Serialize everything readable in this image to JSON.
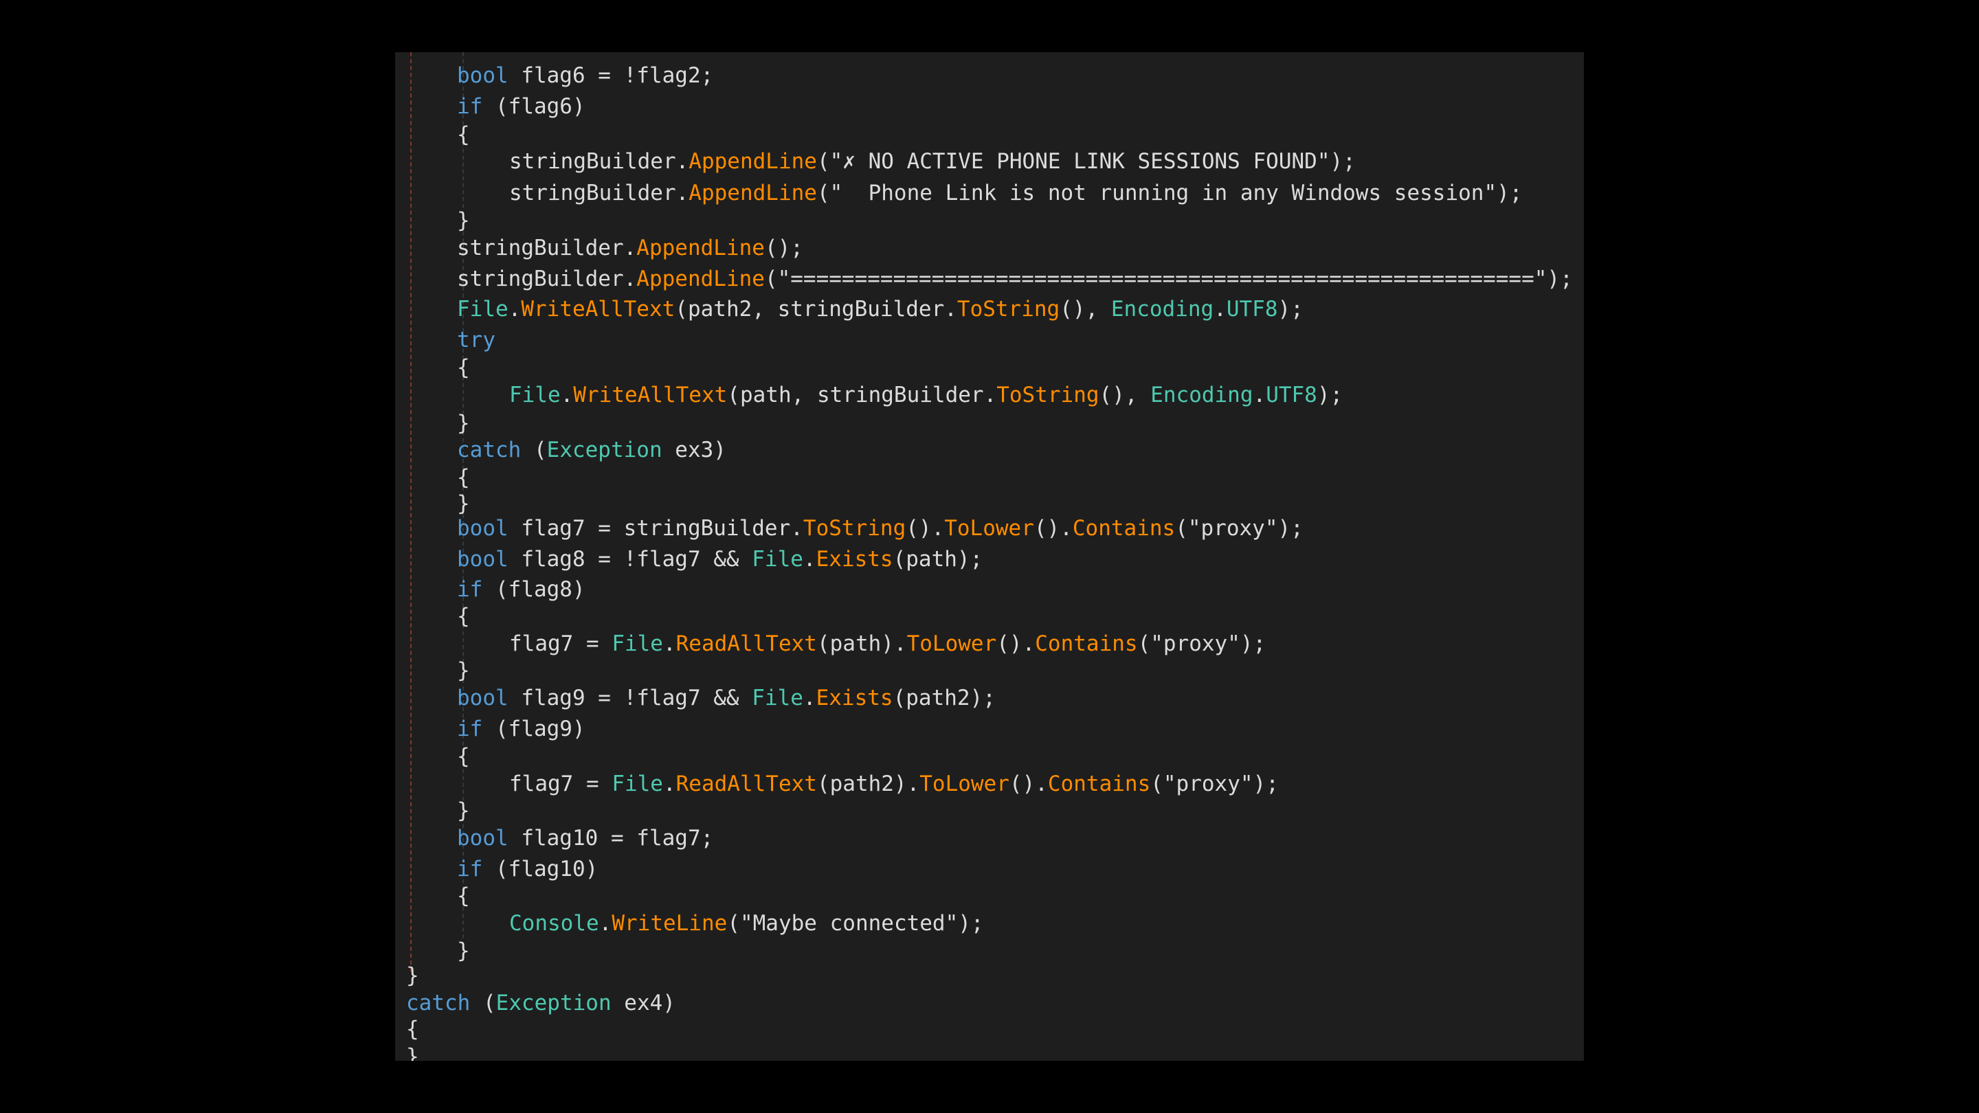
{
  "editor": {
    "theme": {
      "background": "#1e1e1e",
      "keyword": "#569cd6",
      "type": "#4ec9b0",
      "method": "#ff8c00",
      "text": "#dcdcdc"
    },
    "lines": [
      {
        "indent": 1,
        "tokens": [
          [
            "kw",
            "bool"
          ],
          [
            "id",
            " flag6 = !flag2;"
          ]
        ]
      },
      {
        "indent": 1,
        "tokens": [
          [
            "kw",
            "if"
          ],
          [
            "id",
            " (flag6)"
          ]
        ]
      },
      {
        "indent": 1,
        "tokens": [
          [
            "pn",
            "{"
          ]
        ]
      },
      {
        "indent": 2,
        "tokens": [
          [
            "id",
            "stringBuilder."
          ],
          [
            "mth",
            "AppendLine"
          ],
          [
            "str",
            "(\"✗ NO ACTIVE PHONE LINK SESSIONS FOUND\");"
          ]
        ]
      },
      {
        "indent": 2,
        "tokens": [
          [
            "id",
            "stringBuilder."
          ],
          [
            "mth",
            "AppendLine"
          ],
          [
            "str",
            "(\"  Phone Link is not running in any Windows session\");"
          ]
        ]
      },
      {
        "indent": 1,
        "tokens": [
          [
            "pn",
            "}"
          ]
        ]
      },
      {
        "indent": 1,
        "tokens": [
          [
            "id",
            "stringBuilder."
          ],
          [
            "mth",
            "AppendLine"
          ],
          [
            "pn",
            "();"
          ]
        ]
      },
      {
        "indent": 1,
        "tokens": [
          [
            "id",
            "stringBuilder."
          ],
          [
            "mth",
            "AppendLine"
          ],
          [
            "str",
            "(\"==========================================================\");"
          ]
        ]
      },
      {
        "indent": 1,
        "tokens": [
          [
            "ty",
            "File"
          ],
          [
            "pn",
            "."
          ],
          [
            "mth",
            "WriteAllText"
          ],
          [
            "id",
            "(path2, stringBuilder."
          ],
          [
            "mth",
            "ToString"
          ],
          [
            "pn",
            "(), "
          ],
          [
            "ty",
            "Encoding"
          ],
          [
            "pn",
            "."
          ],
          [
            "ty",
            "UTF8"
          ],
          [
            "pn",
            ");"
          ]
        ]
      },
      {
        "indent": 1,
        "tokens": [
          [
            "kw",
            "try"
          ]
        ]
      },
      {
        "indent": 1,
        "tokens": [
          [
            "pn",
            "{"
          ]
        ]
      },
      {
        "indent": 2,
        "tokens": [
          [
            "ty",
            "File"
          ],
          [
            "pn",
            "."
          ],
          [
            "mth",
            "WriteAllText"
          ],
          [
            "id",
            "(path, stringBuilder."
          ],
          [
            "mth",
            "ToString"
          ],
          [
            "pn",
            "(), "
          ],
          [
            "ty",
            "Encoding"
          ],
          [
            "pn",
            "."
          ],
          [
            "ty",
            "UTF8"
          ],
          [
            "pn",
            ");"
          ]
        ]
      },
      {
        "indent": 1,
        "tokens": [
          [
            "pn",
            "}"
          ]
        ]
      },
      {
        "indent": 1,
        "tokens": [
          [
            "kw",
            "catch"
          ],
          [
            "pn",
            " ("
          ],
          [
            "ty",
            "Exception"
          ],
          [
            "id",
            " ex3)"
          ]
        ]
      },
      {
        "indent": 1,
        "tokens": [
          [
            "pn",
            "{"
          ]
        ]
      },
      {
        "indent": 1,
        "tokens": [
          [
            "pn",
            "}"
          ]
        ]
      },
      {
        "indent": 1,
        "tokens": [
          [
            "kw",
            "bool"
          ],
          [
            "id",
            " flag7 = stringBuilder."
          ],
          [
            "mth",
            "ToString"
          ],
          [
            "pn",
            "()."
          ],
          [
            "mth",
            "ToLower"
          ],
          [
            "pn",
            "()."
          ],
          [
            "mth",
            "Contains"
          ],
          [
            "str",
            "(\"proxy\");"
          ]
        ]
      },
      {
        "indent": 1,
        "tokens": [
          [
            "kw",
            "bool"
          ],
          [
            "id",
            " flag8 = !flag7 && "
          ],
          [
            "ty",
            "File"
          ],
          [
            "pn",
            "."
          ],
          [
            "mth",
            "Exists"
          ],
          [
            "id",
            "(path);"
          ]
        ]
      },
      {
        "indent": 1,
        "tokens": [
          [
            "kw",
            "if"
          ],
          [
            "id",
            " (flag8)"
          ]
        ]
      },
      {
        "indent": 1,
        "tokens": [
          [
            "pn",
            "{"
          ]
        ]
      },
      {
        "indent": 2,
        "tokens": [
          [
            "id",
            "flag7 = "
          ],
          [
            "ty",
            "File"
          ],
          [
            "pn",
            "."
          ],
          [
            "mth",
            "ReadAllText"
          ],
          [
            "id",
            "(path)."
          ],
          [
            "mth",
            "ToLower"
          ],
          [
            "pn",
            "()."
          ],
          [
            "mth",
            "Contains"
          ],
          [
            "str",
            "(\"proxy\");"
          ]
        ]
      },
      {
        "indent": 1,
        "tokens": [
          [
            "pn",
            "}"
          ]
        ]
      },
      {
        "indent": 1,
        "tokens": [
          [
            "kw",
            "bool"
          ],
          [
            "id",
            " flag9 = !flag7 && "
          ],
          [
            "ty",
            "File"
          ],
          [
            "pn",
            "."
          ],
          [
            "mth",
            "Exists"
          ],
          [
            "id",
            "(path2);"
          ]
        ]
      },
      {
        "indent": 1,
        "tokens": [
          [
            "kw",
            "if"
          ],
          [
            "id",
            " (flag9)"
          ]
        ]
      },
      {
        "indent": 1,
        "tokens": [
          [
            "pn",
            "{"
          ]
        ]
      },
      {
        "indent": 2,
        "tokens": [
          [
            "id",
            "flag7 = "
          ],
          [
            "ty",
            "File"
          ],
          [
            "pn",
            "."
          ],
          [
            "mth",
            "ReadAllText"
          ],
          [
            "id",
            "(path2)."
          ],
          [
            "mth",
            "ToLower"
          ],
          [
            "pn",
            "()."
          ],
          [
            "mth",
            "Contains"
          ],
          [
            "str",
            "(\"proxy\");"
          ]
        ]
      },
      {
        "indent": 1,
        "tokens": [
          [
            "pn",
            "}"
          ]
        ]
      },
      {
        "indent": 1,
        "tokens": [
          [
            "kw",
            "bool"
          ],
          [
            "id",
            " flag10 = flag7;"
          ]
        ]
      },
      {
        "indent": 1,
        "tokens": [
          [
            "kw",
            "if"
          ],
          [
            "id",
            " (flag10)"
          ]
        ]
      },
      {
        "indent": 1,
        "tokens": [
          [
            "pn",
            "{"
          ]
        ]
      },
      {
        "indent": 2,
        "tokens": [
          [
            "ty",
            "Console"
          ],
          [
            "pn",
            "."
          ],
          [
            "mth",
            "WriteLine"
          ],
          [
            "str",
            "(\"Maybe connected\");"
          ]
        ]
      },
      {
        "indent": 1,
        "tokens": [
          [
            "pn",
            "}"
          ]
        ]
      },
      {
        "indent": 0,
        "tokens": [
          [
            "pn",
            "}"
          ]
        ]
      },
      {
        "indent": 0,
        "tokens": [
          [
            "kw",
            "catch"
          ],
          [
            "pn",
            " ("
          ],
          [
            "ty",
            "Exception"
          ],
          [
            "id",
            " ex4)"
          ]
        ]
      },
      {
        "indent": 0,
        "tokens": [
          [
            "pn",
            "{"
          ]
        ]
      },
      {
        "indent": 0,
        "tokens": [
          [
            "pn",
            "}"
          ]
        ]
      }
    ]
  }
}
